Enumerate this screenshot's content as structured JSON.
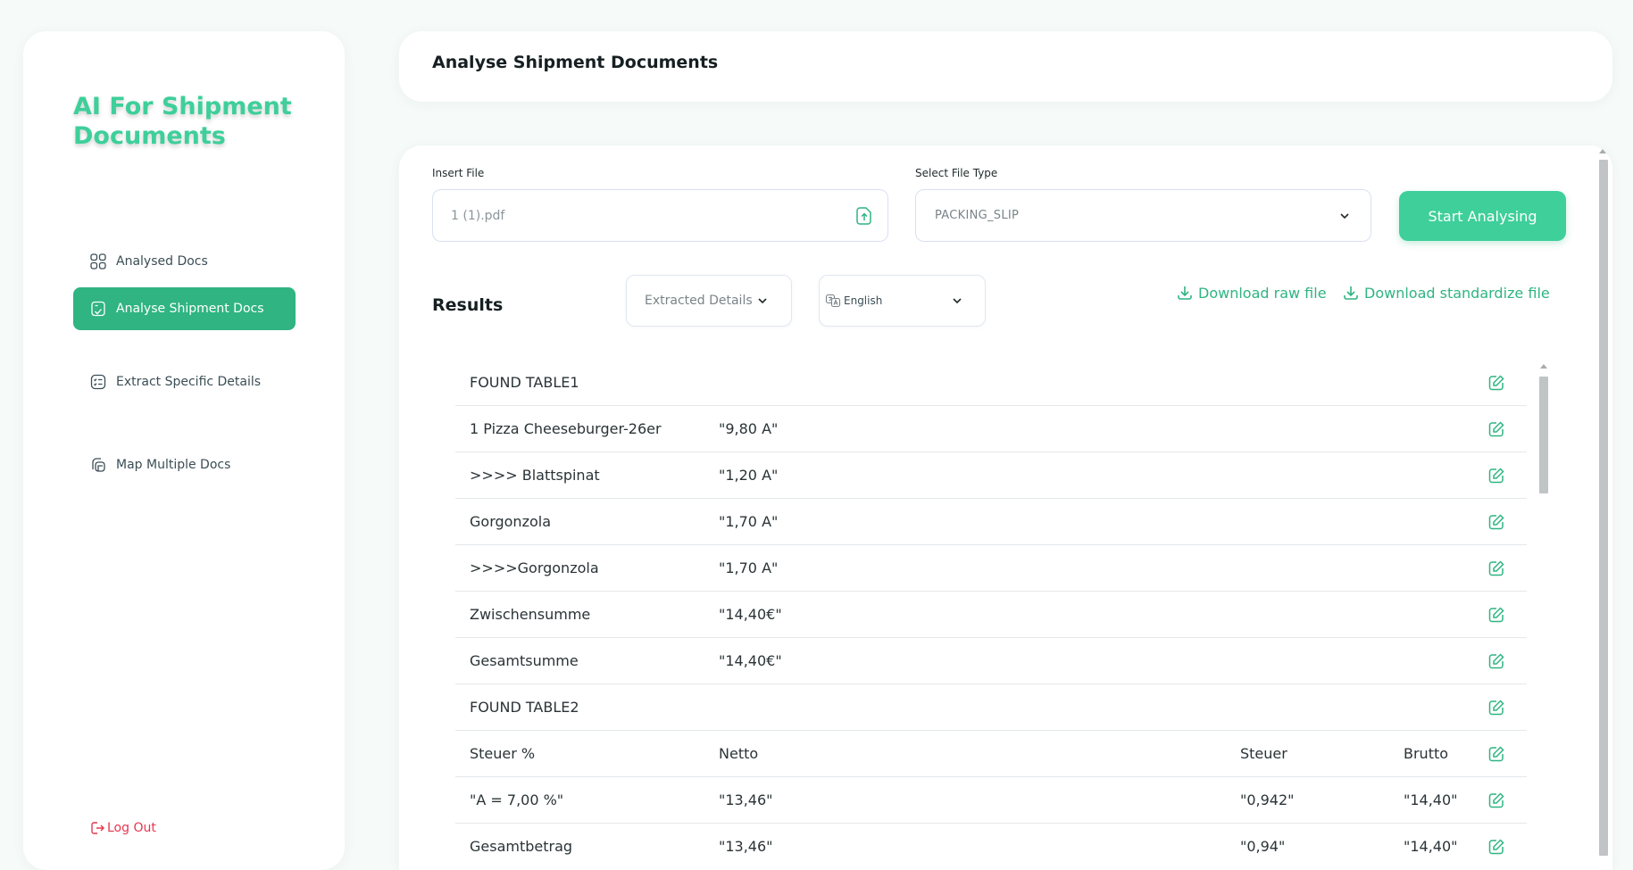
{
  "sidebar": {
    "brand": "AI For Shipment Documents",
    "items": [
      {
        "label": "Analysed Docs",
        "icon": "grid-icon"
      },
      {
        "label": "Analyse Shipment Docs",
        "icon": "doc-check-icon"
      },
      {
        "label": "Extract Specific Details",
        "icon": "list-icon"
      },
      {
        "label": "Map Multiple Docs",
        "icon": "docs-map-icon"
      }
    ],
    "logout": "Log Out"
  },
  "header": {
    "title": "Analyse Shipment Documents"
  },
  "form": {
    "file_label": "Insert File",
    "file_value": "1 (1).pdf",
    "type_label": "Select File Type",
    "type_value": "PACKING_SLIP",
    "start_button": "Start Analysing"
  },
  "results": {
    "title": "Results",
    "view_select": "Extracted Details",
    "language_select": "English",
    "download_raw": "Download raw file",
    "download_std": "Download standardize file",
    "rows": [
      [
        "FOUND TABLE1",
        "",
        "",
        ""
      ],
      [
        "1 Pizza Cheeseburger-26er",
        "\"9,80 A\"",
        "",
        ""
      ],
      [
        ">>>> Blattspinat",
        "\"1,20 A\"",
        "",
        ""
      ],
      [
        "Gorgonzola",
        "\"1,70 A\"",
        "",
        ""
      ],
      [
        ">>>>Gorgonzola",
        "\"1,70 A\"",
        "",
        ""
      ],
      [
        "Zwischensumme",
        "\"14,40€\"",
        "",
        ""
      ],
      [
        "Gesamtsumme",
        "\"14,40€\"",
        "",
        ""
      ],
      [
        "FOUND TABLE2",
        "",
        "",
        ""
      ],
      [
        "Steuer %",
        "Netto",
        "Steuer",
        "Brutto"
      ],
      [
        "\"A = 7,00 %\"",
        "\"13,46\"",
        "\"0,942\"",
        "\"14,40\""
      ],
      [
        "Gesamtbetrag",
        "\"13,46\"",
        "\"0,94\"",
        "\"14,40\""
      ]
    ]
  },
  "colors": {
    "accent": "#3ecf9a",
    "accent_dark": "#2fb482",
    "danger": "#e8364f"
  }
}
